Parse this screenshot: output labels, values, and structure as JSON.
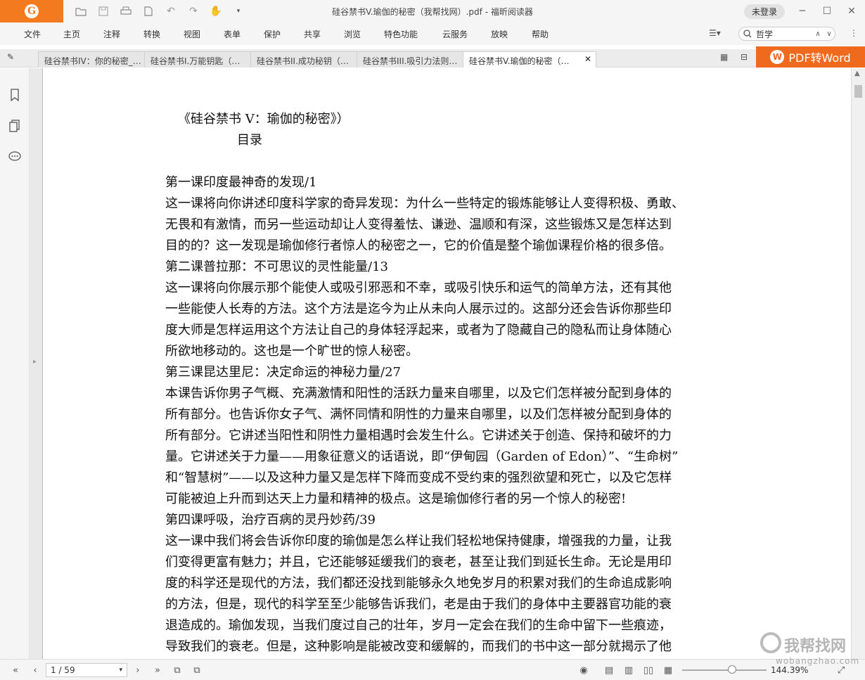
{
  "window": {
    "title": "硅谷禁书V.瑜伽的秘密（我帮找网）.pdf - 福昕阅读器",
    "login_label": "未登录"
  },
  "menu": [
    "文件",
    "主页",
    "注释",
    "转换",
    "视图",
    "表单",
    "保护",
    "共享",
    "浏览",
    "特色功能",
    "云服务",
    "放映",
    "帮助"
  ],
  "search": {
    "value": "哲学"
  },
  "tabs": [
    {
      "label": "硅谷禁书IV：你的秘密_…",
      "active": false
    },
    {
      "label": "硅谷禁书I.万能钥匙（…",
      "active": false
    },
    {
      "label": "硅谷禁书II.成功秘钥（…",
      "active": false
    },
    {
      "label": "硅谷禁书III.吸引力法则…",
      "active": false
    },
    {
      "label": "硅谷禁书V.瑜伽的秘密（…",
      "active": true
    }
  ],
  "pdf_to_word": "PDF转Word",
  "document": {
    "title": "《硅谷禁书 V：瑜伽的秘密》）",
    "toc": "目录",
    "lines": [
      "第一课印度最神奇的发现/1",
      "这一课将向你讲述印度科学家的奇异发现：为什么一些特定的锻炼能够让人变得积极、勇敢、",
      "无畏和有激情，而另一些运动却让人变得羞怯、谦逊、温顺和有深，这些锻炼又是怎样达到",
      "目的的？这一发现是瑜伽修行者惊人的秘密之一，它的价值是整个瑜伽课程价格的很多倍。",
      "第二课普拉那：不可思议的灵性能量/13",
      "这一课将向你展示那个能使人或吸引邪恶和不幸，或吸引快乐和运气的简单方法，还有其他",
      "一些能使人长寿的方法。这个方法是迄今为止从未向人展示过的。这部分还会告诉你那些印",
      "度大师是怎样运用这个方法让自己的身体轻浮起来，或者为了隐藏自己的隐私而让身体随心",
      "所欲地移动的。这也是一个旷世的惊人秘密。",
      "第三课昆达里尼：决定命运的神秘力量/27",
      "本课告诉你男子气概、充满激情和阳性的活跃力量来自哪里，以及它们怎样被分配到身体的",
      "所有部分。也告诉你女子气、满怀同情和阴性的力量来自哪里，以及们怎样被分配到身体的",
      "所有部分。它讲述当阳性和阴性力量相遇时会发生什么。它讲述关于创造、保持和破坏的力",
      "量。它讲述关于力量——用象征意义的话语说，即“伊甸园（Garden of Edon）”、“生命树”",
      "和“智慧树”——以及这种力量又是怎样下降而变成不受约束的强烈欲望和死亡，以及它怎样",
      "可能被迫上升而到达天上力量和精神的极点。这是瑜伽修行者的另一个惊人的秘密!",
      "第四课呼吸，治疗百病的灵丹妙药/39",
      "这一课中我们将会告诉你印度的瑜伽是怎么样让我们轻松地保持健康，增强我的力量，让我",
      "们变得更富有魅力；并且，它还能够延缓我们的衰老，甚至让我们到延长生命。无论是用印",
      "度的科学还是现代的方法，我们都还没找到能够永久地免岁月的积累对我们的生命追成影响",
      "的方法，但是，现代的科学至至少能够告诉我们，老是由于我们的身体中主要器官功能的衰",
      "退造成的。瑜伽发现，当我们度过自己的壮年，岁月一定会在我们的生命中留下一些痕迹，",
      "导致我们的衰老。但是，这种影响是能被改变和缓解的，而我们的书中这一部分就揭示了他"
    ]
  },
  "status": {
    "page": "1 / 59",
    "zoom": "144.39%"
  },
  "watermark": {
    "text": "我帮找网",
    "url": "wobangzhao.com"
  }
}
